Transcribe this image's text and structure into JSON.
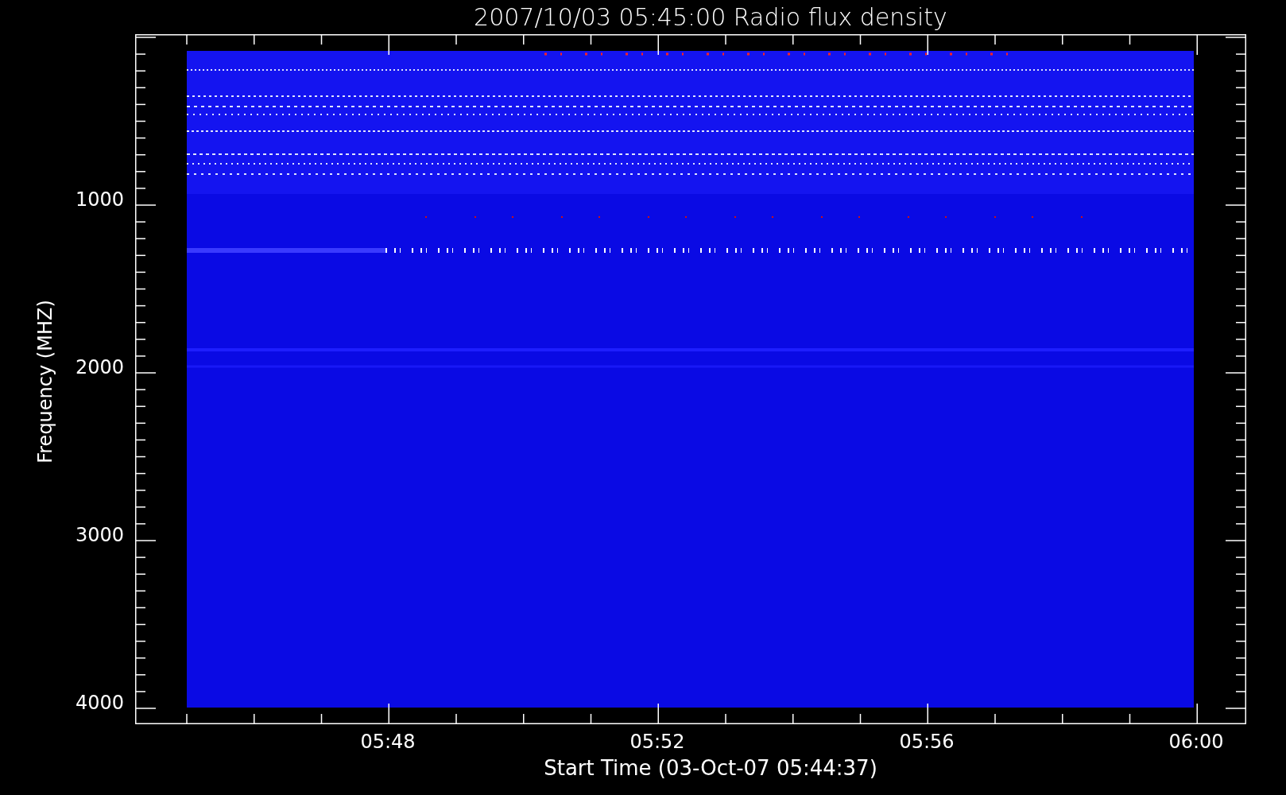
{
  "title": "2007/10/03 05:45:00 Radio flux density",
  "y_axis": {
    "label": "Frequency (MHZ)",
    "ticks": [
      "1000",
      "2000",
      "3000",
      "4000"
    ]
  },
  "x_axis": {
    "label": "Start Time (03-Oct-07 05:44:37)",
    "ticks": [
      "05:48",
      "05:52",
      "05:56",
      "06:00"
    ]
  }
}
